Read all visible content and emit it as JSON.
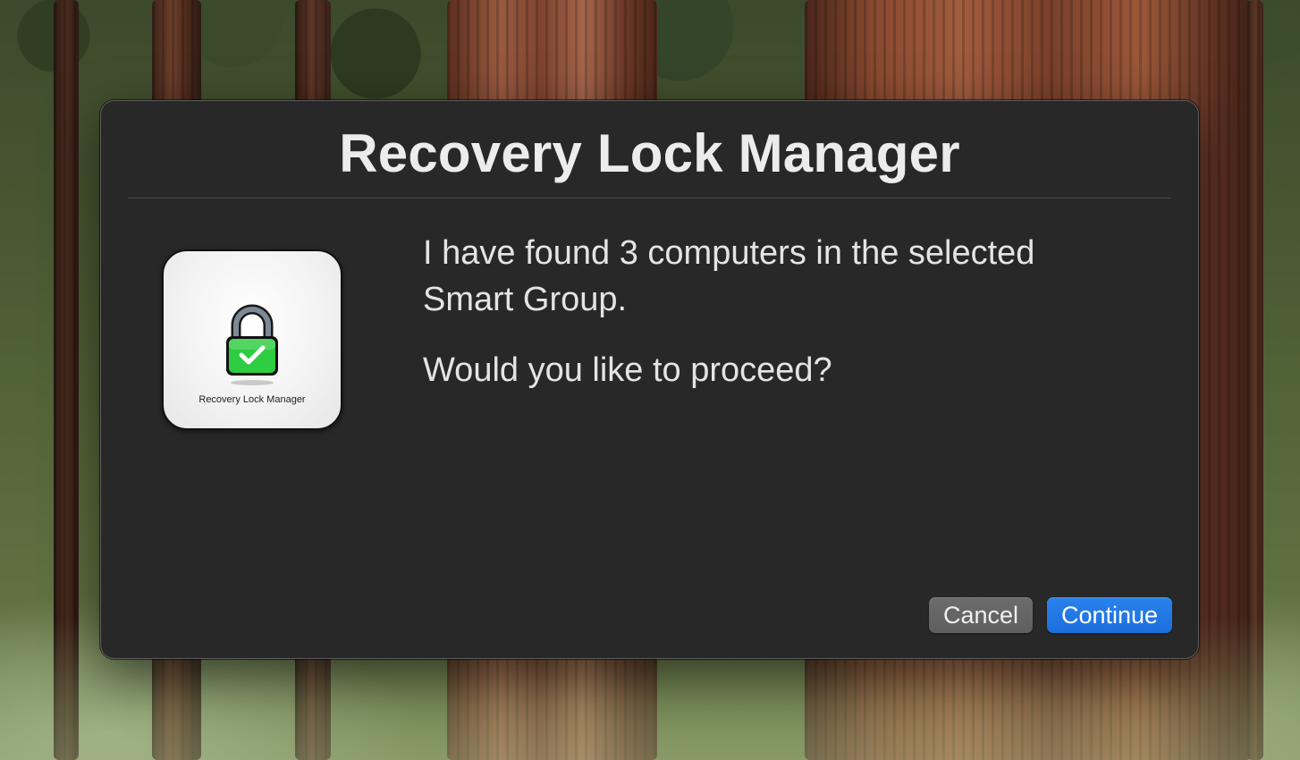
{
  "dialog": {
    "title": "Recovery Lock Manager",
    "app_icon": {
      "icon": "padlock-checkmark-icon",
      "caption": "Recovery Lock Manager",
      "lock_color": "#2ecc40"
    },
    "message_lines": [
      "I have found 3 computers in the selected Smart Group.",
      "Would you like to proceed?"
    ],
    "buttons": {
      "cancel_label": "Cancel",
      "continue_label": "Continue"
    }
  },
  "colors": {
    "dialog_background": "#282828",
    "primary_button": "#1b6fdc",
    "secondary_button": "#626262",
    "text": "#e4e4e4"
  }
}
